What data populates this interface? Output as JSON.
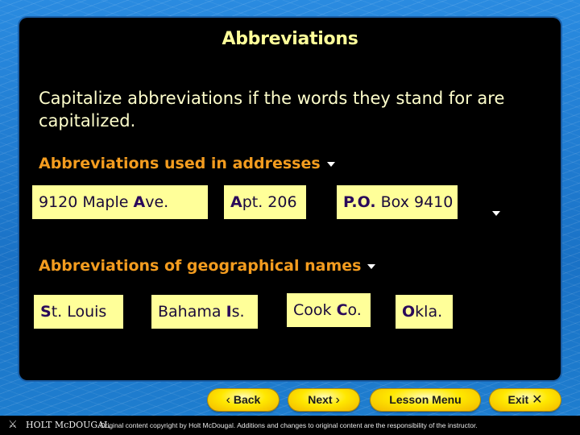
{
  "slide": {
    "title": "Abbreviations",
    "rule": "Capitalize abbreviations if the words they stand for are capitalized."
  },
  "sections": [
    {
      "heading": "Abbreviations used in addresses",
      "examples": [
        {
          "pre": "9120 Maple ",
          "bold": "A",
          "post": "ve."
        },
        {
          "pre": "",
          "bold": "A",
          "post": "pt. 206"
        },
        {
          "pre": "",
          "bold": "P.O.",
          "post": " Box 9410"
        }
      ]
    },
    {
      "heading": "Abbreviations of geographical names",
      "examples": [
        {
          "pre": "",
          "bold": "S",
          "post": "t. Louis"
        },
        {
          "pre": "Bahama ",
          "bold": "I",
          "post": "s."
        },
        {
          "pre": "Cook ",
          "bold": "C",
          "post": "o."
        },
        {
          "pre": "",
          "bold": "O",
          "post": "kla."
        }
      ]
    }
  ],
  "nav": {
    "back": {
      "label": "Back",
      "icon": "‹"
    },
    "next": {
      "label": "Next",
      "icon": "›"
    },
    "menu": {
      "label": "Lesson Menu"
    },
    "exit": {
      "label": "Exit",
      "icon": "✕"
    }
  },
  "footer": {
    "logo_icon": "⚔",
    "logo": "HOLT McDOUGAL",
    "copyright": "Original content copyright by Holt McDougal. Additions and changes to original content are the responsibility of the instructor."
  },
  "colors": {
    "title": "#ffff99",
    "heading": "#f39c1f",
    "box": "#ffff99",
    "button": "#ffe800"
  }
}
